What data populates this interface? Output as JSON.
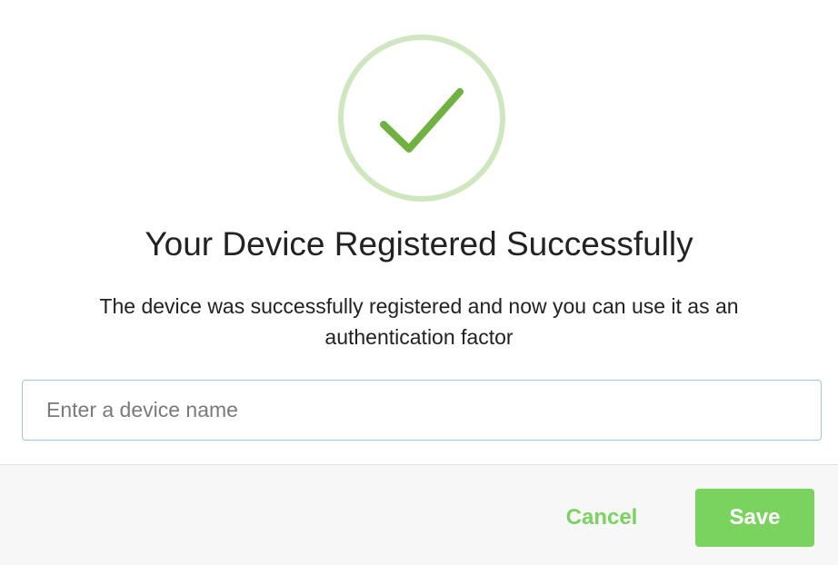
{
  "dialog": {
    "icon": "checkmark-circle-icon",
    "title": "Your Device Registered Successfully",
    "description": "The device was successfully registered and now you can use it as an authentication factor",
    "device_name": {
      "placeholder": "Enter a device name",
      "value": ""
    }
  },
  "footer": {
    "cancel_label": "Cancel",
    "save_label": "Save"
  },
  "colors": {
    "accent": "#7ad25f",
    "check": "#6fb242",
    "ring": "#cfe6bf",
    "input_border": "#9fc5e0",
    "footer_bg": "#f7f7f8"
  }
}
